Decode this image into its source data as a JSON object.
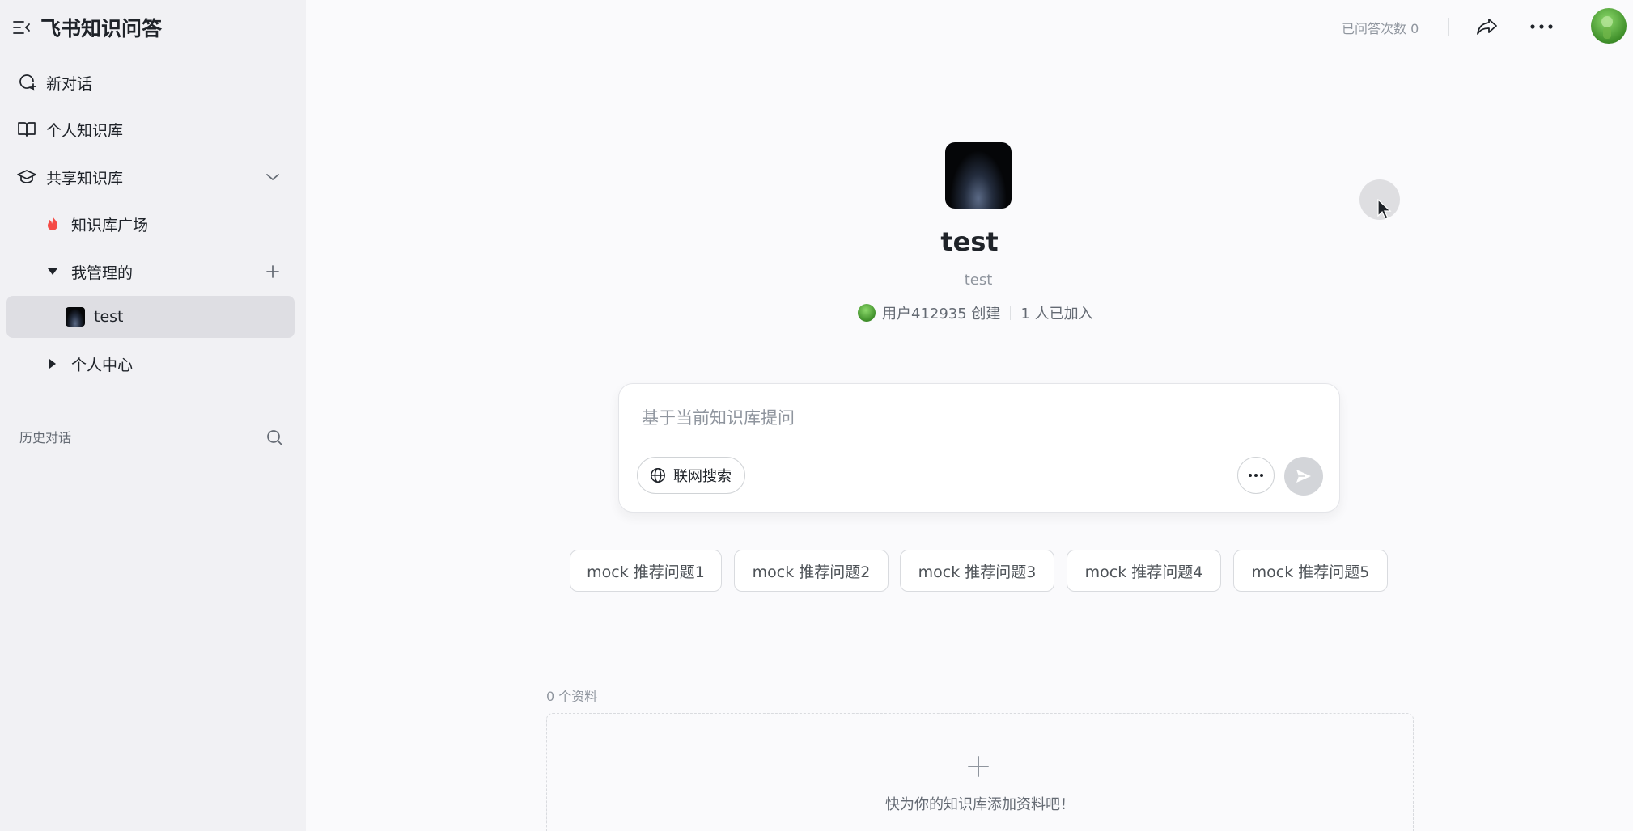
{
  "app": {
    "title": "飞书知识问答"
  },
  "sidebar": {
    "new_chat": "新对话",
    "personal_kb": "个人知识库",
    "shared_kb": "共享知识库",
    "kb_square": "知识库广场",
    "managed": "我管理的",
    "kb_item": "test",
    "personal_center": "个人中心",
    "history_label": "历史对话"
  },
  "topbar": {
    "answer_count": "已问答次数 0"
  },
  "kb": {
    "name": "test",
    "description": "test",
    "creator": "用户412935 创建",
    "members": "1 人已加入"
  },
  "composer": {
    "placeholder": "基于当前知识库提问",
    "web_search_label": "联网搜索"
  },
  "suggestions": [
    "mock 推荐问题1",
    "mock 推荐问题2",
    "mock 推荐问题3",
    "mock 推荐问题4",
    "mock 推荐问题5"
  ],
  "materials": {
    "count_label": "0 个资料",
    "empty_hint": "快为你的知识库添加资料吧！"
  },
  "colors": {
    "sidebar_bg": "#f1f1f4",
    "page_bg": "#fafafc",
    "active_item": "#dedee3",
    "fire": "#f54a45"
  }
}
